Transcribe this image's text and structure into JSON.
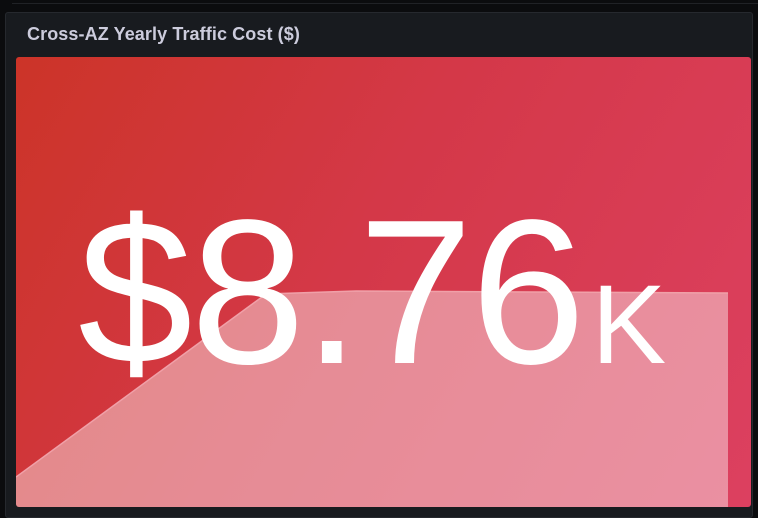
{
  "panel": {
    "title": "Cross-AZ Yearly Traffic Cost ($)"
  },
  "stat": {
    "value": "$8.76",
    "unit": "K",
    "background_color_start": "#cc3428",
    "background_color_end": "#dc4060",
    "sparkline_fill": "rgba(255,255,255,0.42)",
    "sparkline_stroke": "#f0a0a8"
  }
}
